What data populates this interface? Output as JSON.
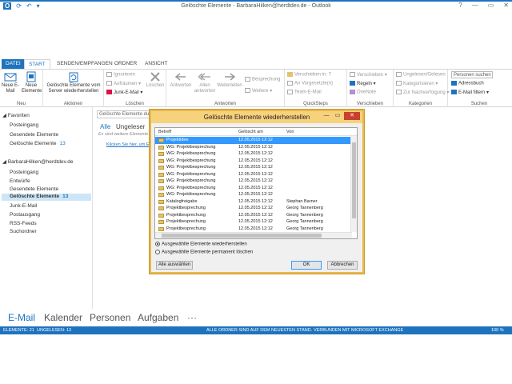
{
  "window": {
    "title": "Gelöschte Elemente - BarbaraHilken@herdtdev.de - Outlook",
    "minimize": "—",
    "restore": "▭",
    "close": "✕"
  },
  "tabs": [
    "DATEI",
    "START",
    "SENDEN/EMPFANGEN",
    "ORDNER",
    "ANSICHT"
  ],
  "ribbon": {
    "neu": {
      "label": "Neu",
      "new_email": "Neue E-Mail",
      "new_items": "Neue Elemente"
    },
    "aktionen": {
      "label": "Aktionen",
      "restore_deleted": "Gelöschte Elemente vom Server wiederherstellen"
    },
    "loeschen": {
      "label": "Löschen",
      "ignore": "Ignorieren",
      "cleanup": "Aufräumen",
      "junk": "Junk-E-Mail",
      "delete": "Löschen"
    },
    "antworten": {
      "label": "Antworten",
      "reply": "Antworten",
      "reply_all": "Allen antworten",
      "forward": "Weiterleiten",
      "meeting": "Besprechung",
      "more": "Weitere"
    },
    "quicksteps": {
      "label": "QuickSteps",
      "move_to": "Verschieben in: ?",
      "to_manager": "An Vorgesetzte(n)",
      "team_email": "Team-E-Mail"
    },
    "verschieben": {
      "label": "Verschieben",
      "move": "Verschieben",
      "rules": "Regeln",
      "onenote": "OneNote"
    },
    "kategorien": {
      "label": "Kategorien",
      "unread_read": "Ungelesen/Gelesen",
      "categorize": "Kategorisieren",
      "followup": "Zur Nachverfolgung"
    },
    "suchen": {
      "label": "Suchen",
      "search_people": "Personen suchen",
      "address_book": "Adressbuch",
      "filter_email": "E-Mail filtern"
    }
  },
  "nav": {
    "favorites_header": "Favoriten",
    "favorites": [
      {
        "label": "Posteingang",
        "count": ""
      },
      {
        "label": "Gesendete Elemente",
        "count": ""
      },
      {
        "label": "Gelöschte Elemente",
        "count": "13"
      }
    ],
    "account": "BarbaraHilken@herdtdev.de",
    "folders": [
      {
        "label": "Posteingang",
        "count": ""
      },
      {
        "label": "Entwürfe",
        "count": ""
      },
      {
        "label": "Gesendete Elemente",
        "count": ""
      },
      {
        "label": "Gelöschte Elemente",
        "count": "13"
      },
      {
        "label": "Junk-E-Mail",
        "count": ""
      },
      {
        "label": "Postausgang",
        "count": ""
      },
      {
        "label": "RSS-Feeds",
        "count": ""
      },
      {
        "label": "Suchordner",
        "count": ""
      }
    ]
  },
  "main": {
    "search_placeholder": "Gelöschte Elemente du",
    "filter_all": "Alle",
    "filter_unread": "Ungeleser",
    "note": "Es sind weitere Elemente in",
    "link": "Klicken Sie hier, um Exc"
  },
  "dialog": {
    "title": "Gelöschte Elemente wiederherstellen",
    "columns": {
      "subject": "Betreff",
      "deleted": "Gelöscht am",
      "from": "Von"
    },
    "rows": [
      {
        "subject": "Projektidee",
        "deleted": "12.05.2015 12:12",
        "from": ""
      },
      {
        "subject": "WG: Projektbesprechung",
        "deleted": "12.05.2015 12:12",
        "from": ""
      },
      {
        "subject": "WG: Projektbesprechung",
        "deleted": "12.05.2015 12:12",
        "from": ""
      },
      {
        "subject": "WG: Projektbesprechung",
        "deleted": "12.05.2015 12:12",
        "from": ""
      },
      {
        "subject": "WG: Projektbesprechung",
        "deleted": "12.05.2015 12:12",
        "from": ""
      },
      {
        "subject": "WG: Projektbesprechung",
        "deleted": "12.05.2015 12:12",
        "from": ""
      },
      {
        "subject": "WG: Projektbesprechung",
        "deleted": "12.05.2015 12:12",
        "from": ""
      },
      {
        "subject": "WG: Projektbesprechung",
        "deleted": "12.05.2015 12:12",
        "from": ""
      },
      {
        "subject": "WG: Projektbesprechung",
        "deleted": "12.05.2015 12:12",
        "from": ""
      },
      {
        "subject": "Katalogfreigabe",
        "deleted": "12.05.2015 12:12",
        "from": "Stephan Barner"
      },
      {
        "subject": "Projektbesprechung",
        "deleted": "12.05.2015 12:12",
        "from": "Georg Tannenberg"
      },
      {
        "subject": "Projektbesprechung",
        "deleted": "12.05.2015 12:12",
        "from": "Georg Tannenberg"
      },
      {
        "subject": "Projektbesprechung",
        "deleted": "12.05.2015 12:12",
        "from": "Georg Tannenberg"
      },
      {
        "subject": "Projektbesprechung",
        "deleted": "12.05.2015 12:12",
        "from": "Georg Tannenberg"
      },
      {
        "subject": "WG: Neuer Webauftritt",
        "deleted": "12.05.2015 12:12",
        "from": "Georg Tannenberg"
      }
    ],
    "radio_restore": "Ausgewählte Elemente wiederherstellen",
    "radio_purge": "Ausgewählte Elemente permanent löschen",
    "select_all": "Alle auswählen",
    "ok": "OK",
    "cancel": "Abbrechen"
  },
  "bottom_nav": [
    "E-Mail",
    "Kalender",
    "Personen",
    "Aufgaben",
    "···"
  ],
  "status": {
    "elements": "ELEMENTE: 21",
    "unread": "UNGELESEN: 13",
    "folders_state": "ALLE ORDNER SIND AUF DEM NEUESTEN STAND.",
    "connection": "VERBUNDEN MIT MICROSOFT EXCHANGE",
    "zoom": "100 %"
  },
  "colors": {
    "accent": "#1e73be",
    "selection": "#3399ff",
    "dialog_frame": "#e9b94a"
  }
}
